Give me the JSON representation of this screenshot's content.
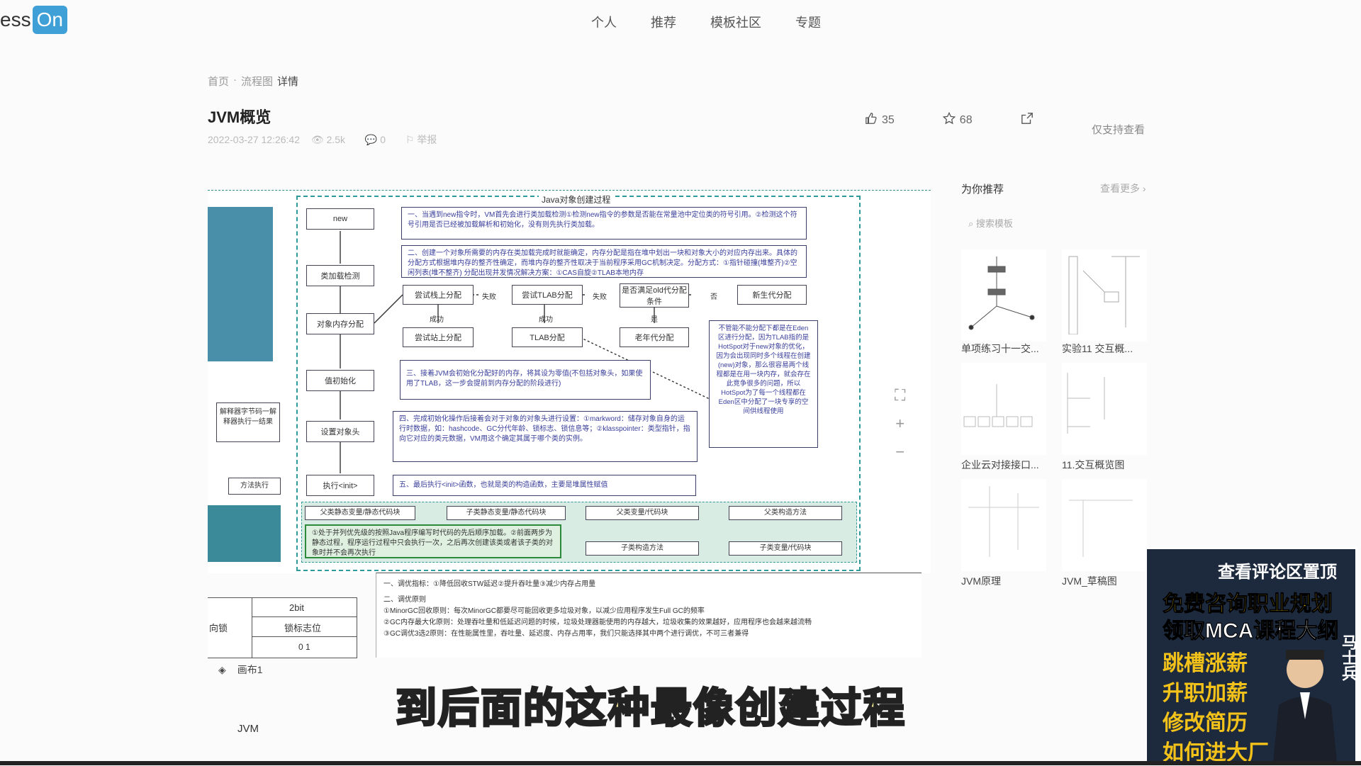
{
  "logo": {
    "text_left": "ess",
    "text_on": "On"
  },
  "nav": [
    "个人",
    "推荐",
    "模板社区",
    "专题"
  ],
  "breadcrumb": {
    "home": "首页",
    "sep": "·",
    "cat": "流程图",
    "current": "详情"
  },
  "page": {
    "title": "JVM概览",
    "date": "2022-03-27 12:26:42",
    "views": "2.5k",
    "comments": "0",
    "license": "举报"
  },
  "actions": {
    "likes": "35",
    "stars": "68",
    "readonly": "仅支持查看"
  },
  "diagram": {
    "title": "Java对象创建过程",
    "steps": [
      "new",
      "类加载检测",
      "对象内存分配",
      "值初始化",
      "设置对象头",
      "执行<init>"
    ],
    "alloc": [
      "尝试栈上分配",
      "尝试TLAB分配",
      "是否满足old代分配条件",
      "新生代分配",
      "尝试站上分配",
      "TLAB分配",
      "老年代分配"
    ],
    "labels": [
      "失败",
      "失败",
      "否",
      "成功",
      "成功",
      "是"
    ],
    "note1": "一、当遇到new指令时，VM首先会进行类加载检测①检测new指令的参数是否能在常量池中定位类的符号引用。②检测这个符号引用是否已经被加载解析和初始化，没有则先执行类加载。",
    "note2": "二、创建一个对象所需要的内存在类加载完成时就能确定，内存分配是指在堆中划出一块和对象大小的对应内存出来。具体的分配方式根据堆内存的整齐性确定，而堆内存的整齐性取决于当前程序采用GC机制决定。分配方式：①指针碰撞(堆整齐)②空闲列表(堆不整齐) 分配出现并发情况解决方案：①CAS自旋②TLAB本地内存",
    "note3": "三、接着JVM会初始化分配好的内存，将其设为零值(不包括对象头，如果使用了TLAB，这一步会提前到内存分配的阶段进行)",
    "note4": "四、完成初始化操作后接着会对于对象的对象头进行设置：①markword：储存对象自身的运行时数据，如：hashcode、GC分代年龄、锁标志、锁信息等；②klasspointer：类型指针，指向它对应的类元数据，VM用这个确定其属于哪个类的实例。",
    "note5": "五、最后执行<init>函数，也就是类的构造函数，主要是堆属性赋值",
    "side_note": "不管能不能分配下都是在Eden区进行分配，因为TLAB指的是HotSpot对于new对象的优化，因为会出现同时多个线程在创建(new)对象，那么很容易两个线程都是在用一块内存，就会存在此竞争很多的问题，所以HotSpot为了每一个线程都在Eden区中分配了一块专享的空间供线程使用",
    "order": [
      "父类静态变量/静态代码块",
      "子类静态变量/静态代码块",
      "父类变量/代码块",
      "父类构造方法",
      "子类构造方法",
      "子类变量/代码块"
    ],
    "order_note": "①处于并列优先级的按照Java程序编写时代码的先后顺序加载。②前面两步为静态过程，程序运行过程中只会执行一次，之后再次创建该类或者该子类的对象时并不会再次执行",
    "left_box": "解释器字节码一解释器执行一结果",
    "left_box2": "方法执行",
    "gc_title": "一、调优指标：①降低回收STW延迟②提升吞吐量③减少内存占用量",
    "gc_sub": "二、调优原则",
    "gc_lines": [
      "①MinorGC回收原则：每次MinorGC都要尽可能回收更多垃圾对象，以减少应用程序发生Full GC的频率",
      "②GC内存最大化原则：处理吞吐量和低延迟问题的时候，垃圾处理器能使用的内存越大，垃圾收集的效果越好，应用程序也会越来越流畅",
      "③GC调优3选2原则：在性能属性里，吞吐量、延迟度、内存占用率，我们只能选择其中两个进行调优，不可三者兼得"
    ],
    "table": {
      "header": "2bit",
      "row_left": "向锁",
      "row_right": "锁标志位",
      "row2": "0 1"
    }
  },
  "canvas_tools": [
    "⛶",
    "+",
    "−"
  ],
  "layer": {
    "name": "画布1"
  },
  "bottom_tab": "JVM",
  "recommend": {
    "title": "为你推荐",
    "more": "查看更多 ›",
    "search_placeholder": "搜索模板",
    "items": [
      "单项练习十一交...",
      "实验11 交互概...",
      "企业云对接接口...",
      "11.交互概览图",
      "JVM原理",
      "JVM_草稿图"
    ]
  },
  "ad": {
    "lines": [
      "查看评论区置顶",
      "免费咨询职业规划",
      "领取MCA课程大纲",
      "跳槽涨薪",
      "升职加薪",
      "修改简历",
      "如何进大厂"
    ],
    "name": "马士兵"
  },
  "subtitle": "到后面的这种最像创建过程"
}
